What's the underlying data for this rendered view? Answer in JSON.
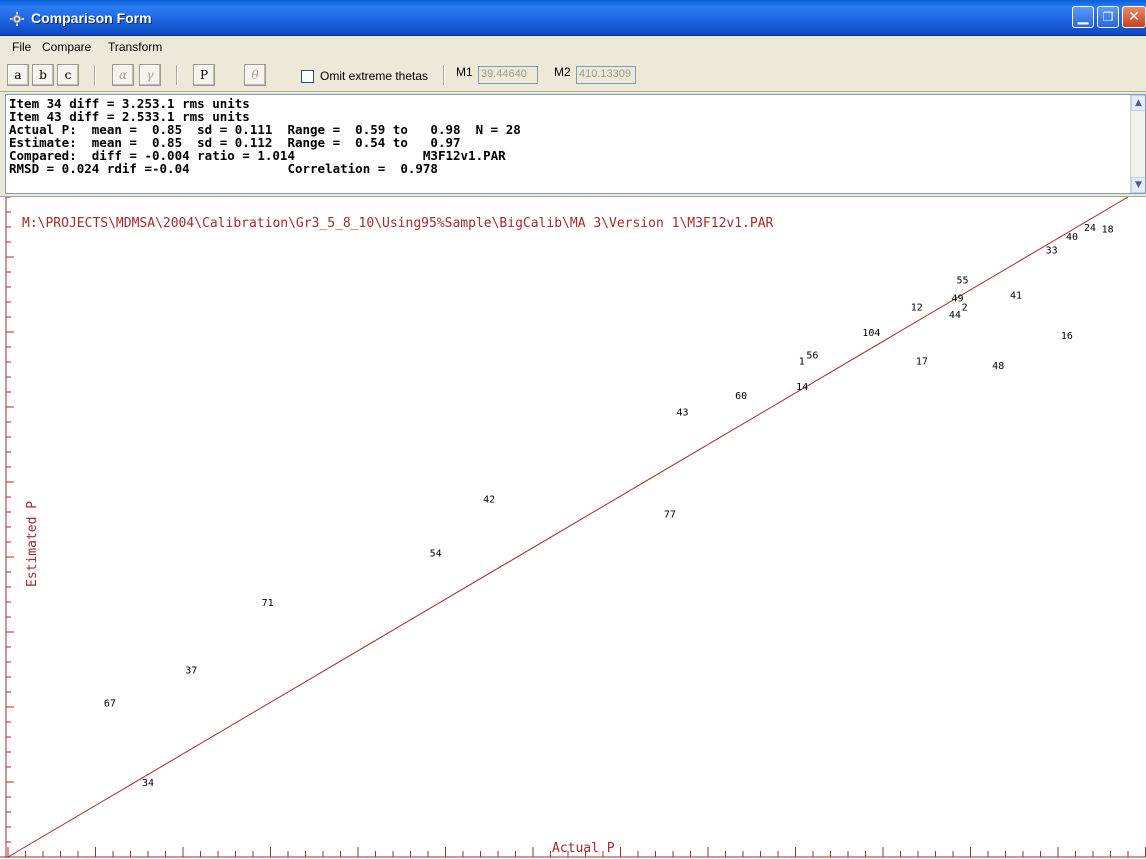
{
  "window": {
    "title": "Comparison Form",
    "icon": "gear-icon"
  },
  "menu": [
    "File",
    "Compare",
    "Transform"
  ],
  "toolbar": {
    "buttons": [
      "a",
      "b",
      "c",
      "α",
      "γ",
      "P",
      "θ"
    ],
    "omit_label": "Omit extreme thetas",
    "omit_checked": false,
    "m1_label": "M1",
    "m1_value": "39.44640",
    "m2_label": "M2",
    "m2_value": "410.13309"
  },
  "stats_lines": [
    "Item 34 diff = 3.253.1 rms units",
    "Item 43 diff = 2.533.1 rms units",
    "Actual P:  mean =  0.85  sd = 0.111  Range =  0.59 to   0.98  N = 28",
    "Estimate:  mean =  0.85  sd = 0.112  Range =  0.54 to   0.97",
    "Compared:  diff = -0.004 ratio = 1.014                 M3F12v1.PAR",
    "RMSD = 0.024 rdif =-0.04             Correlation =  0.978"
  ],
  "plot": {
    "file_path": "M:\\PROJECTS\\MDMSA\\2004\\Calibration\\Gr3_5_8_10\\Using95%Sample\\BigCalib\\MA 3\\Version 1\\M3F12v1.PAR",
    "xlabel": "Actual P",
    "ylabel": "Estimated P",
    "line_color": "#a52a2a",
    "points": [
      {
        "label": "24",
        "x": 0.975,
        "y": 0.97
      },
      {
        "label": "18",
        "x": 0.982,
        "y": 0.969
      },
      {
        "label": "40",
        "x": 0.968,
        "y": 0.964
      },
      {
        "label": "33",
        "x": 0.96,
        "y": 0.955
      },
      {
        "label": "55",
        "x": 0.925,
        "y": 0.935
      },
      {
        "label": "49",
        "x": 0.923,
        "y": 0.923
      },
      {
        "label": "41",
        "x": 0.946,
        "y": 0.925
      },
      {
        "label": "12",
        "x": 0.907,
        "y": 0.917
      },
      {
        "label": "2",
        "x": 0.927,
        "y": 0.917
      },
      {
        "label": "44",
        "x": 0.922,
        "y": 0.912
      },
      {
        "label": "16",
        "x": 0.966,
        "y": 0.898
      },
      {
        "label": "104",
        "x": 0.888,
        "y": 0.9
      },
      {
        "label": "56",
        "x": 0.866,
        "y": 0.885
      },
      {
        "label": "17",
        "x": 0.909,
        "y": 0.881
      },
      {
        "label": "48",
        "x": 0.939,
        "y": 0.878
      },
      {
        "label": "1",
        "x": 0.863,
        "y": 0.881
      },
      {
        "label": "14",
        "x": 0.862,
        "y": 0.864
      },
      {
        "label": "60",
        "x": 0.838,
        "y": 0.858
      },
      {
        "label": "43",
        "x": 0.815,
        "y": 0.847
      },
      {
        "label": "42",
        "x": 0.739,
        "y": 0.789
      },
      {
        "label": "77",
        "x": 0.81,
        "y": 0.779
      },
      {
        "label": "54",
        "x": 0.718,
        "y": 0.753
      },
      {
        "label": "71",
        "x": 0.652,
        "y": 0.72
      },
      {
        "label": "37",
        "x": 0.622,
        "y": 0.675
      },
      {
        "label": "67",
        "x": 0.59,
        "y": 0.653
      },
      {
        "label": "34",
        "x": 0.605,
        "y": 0.6
      }
    ]
  }
}
